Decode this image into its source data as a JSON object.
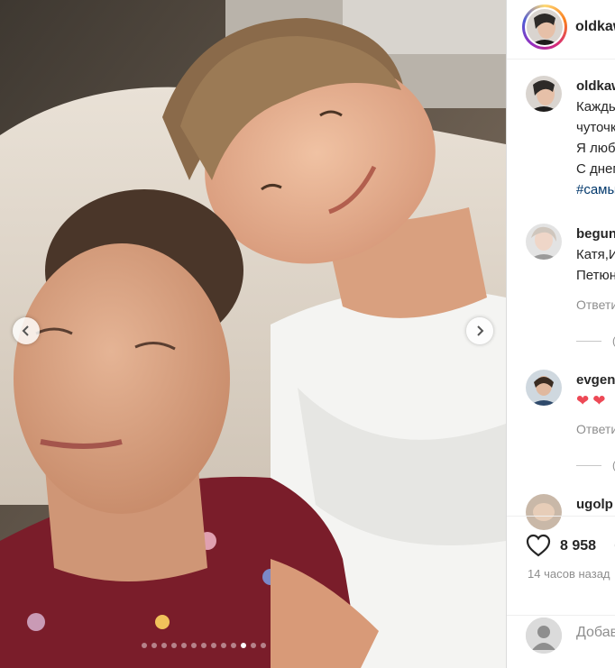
{
  "post": {
    "author": "oldkaw",
    "caption_lines": [
      "Каждь",
      "чуточк",
      "Я любл",
      "С днем",
      "#самы"
    ]
  },
  "comments": [
    {
      "username": "begun",
      "lines": [
        "Катя,И",
        "Петюн"
      ],
      "reply_label": "Ответи"
    },
    {
      "username": "evgen",
      "hearts": "❤❤",
      "reply_label": "Ответи"
    },
    {
      "username": "ugolp"
    }
  ],
  "thread_more": "(",
  "likes_count": "8 958",
  "time_ago": "14 часов назад",
  "add_comment_placeholder": "Добав",
  "carousel": {
    "total": 13,
    "active_index": 10
  },
  "colors": {
    "link": "#00376b",
    "muted": "#8e8e8e",
    "heart": "#ed4956"
  },
  "icons": [
    "chevron-left-icon",
    "chevron-right-icon",
    "heart-icon",
    "comment-icon",
    "default-avatar-icon"
  ]
}
